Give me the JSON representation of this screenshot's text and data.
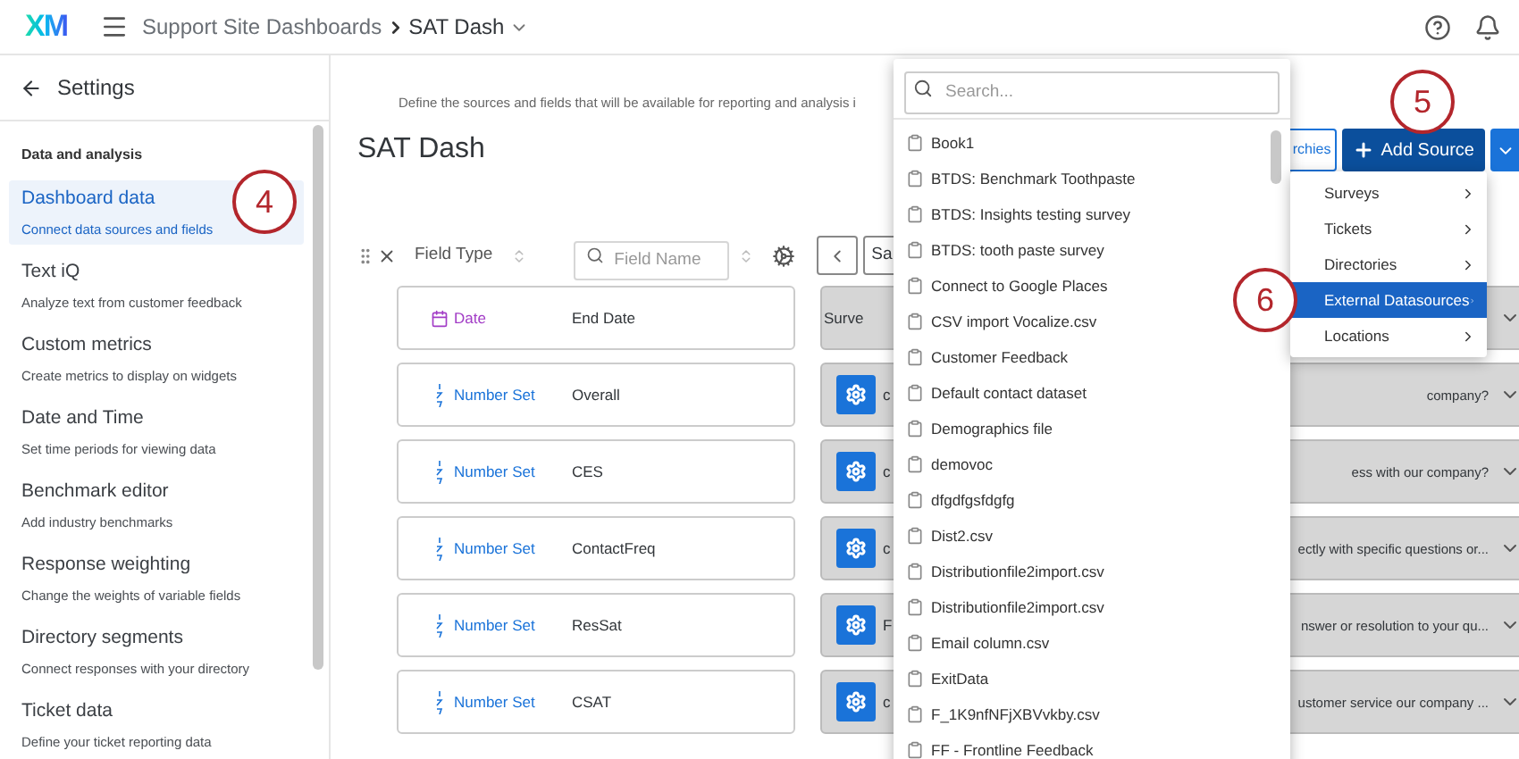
{
  "header": {
    "logo": "XM",
    "breadcrumb": [
      "Support Site Dashboards",
      "SAT Dash"
    ]
  },
  "sidebar": {
    "back_label": "Settings",
    "section": "Data and analysis",
    "items": [
      {
        "title": "Dashboard data",
        "subtitle": "Connect data sources and fields",
        "selected": true
      },
      {
        "title": "Text iQ",
        "subtitle": "Analyze text from customer feedback",
        "selected": false
      },
      {
        "title": "Custom metrics",
        "subtitle": "Create metrics to display on widgets",
        "selected": false
      },
      {
        "title": "Date and Time",
        "subtitle": "Set time periods for viewing data",
        "selected": false
      },
      {
        "title": "Benchmark editor",
        "subtitle": "Add industry benchmarks",
        "selected": false
      },
      {
        "title": "Response weighting",
        "subtitle": "Change the weights of variable fields",
        "selected": false
      },
      {
        "title": "Directory segments",
        "subtitle": "Connect responses with your directory",
        "selected": false
      },
      {
        "title": "Ticket data",
        "subtitle": "Define your ticket reporting data",
        "selected": false
      }
    ]
  },
  "main": {
    "description": "Define the sources and fields that will be available for reporting and analysis i",
    "title": "SAT Dash",
    "hierarchies_button": "rchies",
    "add_source_button": "Add Source",
    "toolbar": {
      "field_type_label": "Field Type",
      "field_name_placeholder": "Field Name",
      "source_button": "Sa"
    },
    "fields": [
      {
        "kind": "date",
        "type_label": "Date",
        "name": "End Date",
        "source_start": "Surve",
        "gear": false
      },
      {
        "kind": "number_set",
        "type_label": "Number Set",
        "name": "Overall",
        "source_start": "c",
        "source_end": "company?",
        "gear": true
      },
      {
        "kind": "number_set",
        "type_label": "Number Set",
        "name": "CES",
        "source_start": "c",
        "source_end": "ess with our company?",
        "gear": true
      },
      {
        "kind": "number_set",
        "type_label": "Number Set",
        "name": "ContactFreq",
        "source_start": "c",
        "source_end": "ectly with specific questions or...",
        "gear": true
      },
      {
        "kind": "number_set",
        "type_label": "Number Set",
        "name": "ResSat",
        "source_start": "F",
        "source_end": "nswer or resolution to your qu...",
        "gear": true
      },
      {
        "kind": "number_set",
        "type_label": "Number Set",
        "name": "CSAT",
        "source_start": "c",
        "source_end": "ustomer service our company ...",
        "gear": true
      }
    ]
  },
  "datasource_dropdown": {
    "search_placeholder": "Search...",
    "items": [
      "Book1",
      "BTDS: Benchmark Toothpaste",
      "BTDS: Insights testing survey",
      "BTDS: tooth paste survey",
      "Connect to Google Places",
      "CSV import Vocalize.csv",
      "Customer Feedback",
      "Default contact dataset",
      "Demographics file",
      "demovoc",
      "dfgdfgsfdgfg",
      "Dist2.csv",
      "Distributionfile2import.csv",
      "Distributionfile2import.csv",
      "Email column.csv",
      "ExitData",
      "F_1K9nfNFjXBVvkby.csv",
      "FF - Frontline Feedback"
    ]
  },
  "add_source_menu": {
    "items": [
      {
        "label": "Surveys",
        "selected": false
      },
      {
        "label": "Tickets",
        "selected": false
      },
      {
        "label": "Directories",
        "selected": false
      },
      {
        "label": "External Datasources",
        "selected": true
      },
      {
        "label": "Locations",
        "selected": false
      }
    ]
  },
  "annotations": [
    "4",
    "5",
    "6"
  ]
}
